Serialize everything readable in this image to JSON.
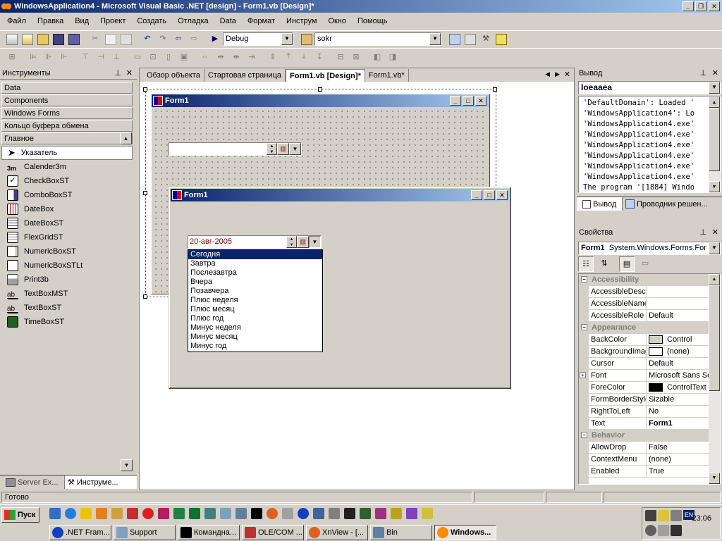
{
  "window": {
    "title": "WindowsApplication4 - Microsoft Visual Basic .NET [design] - Form1.vb [Design]*"
  },
  "menu": [
    "Файл",
    "Правка",
    "Вид",
    "Проект",
    "Создать",
    "Отладка",
    "Data",
    "Формат",
    "Инструм",
    "Окно",
    "Помощь"
  ],
  "toolbar": {
    "config": "Debug",
    "find": "sokr"
  },
  "toolbox": {
    "title": "Инструменты",
    "categories": [
      "Data",
      "Components",
      "Windows Forms",
      "Кольцо буфера обмена",
      "Главное"
    ],
    "items": [
      "Указатель",
      "Calender3m",
      "CheckBoxST",
      "ComboBoxST",
      "DateBox",
      "DateBoxST",
      "FlexGridST",
      "NumericBoxST",
      "NumericBoxSTLt",
      "Print3b",
      "TextBoxMST",
      "TextBoxST",
      "TimeBoxST"
    ],
    "bottom_tabs": [
      "Server Ex...",
      "Инструме..."
    ]
  },
  "doc_tabs": [
    "Обзор объекта",
    "Стартовая страница",
    "Form1.vb [Design]*",
    "Form1.vb*"
  ],
  "designer": {
    "form_title": "Form1"
  },
  "runtime_form": {
    "title": "Form1",
    "date_value": "20-авг-2005",
    "list": [
      "Сегодня",
      "Завтра",
      "Послезавтра",
      "Вчера",
      "Позавчера",
      "Плюс неделя",
      "Плюс месяц",
      "Плюс год",
      "Минус неделя",
      "Минус месяц",
      "Минус год"
    ]
  },
  "output": {
    "title": "Вывод",
    "pane": "Ioeaaea",
    "lines": [
      " 'DefaultDomain': Loaded '",
      " 'WindowsApplication4': Lo",
      " 'WindowsApplication4.exe'",
      " 'WindowsApplication4.exe'",
      " 'WindowsApplication4.exe'",
      " 'WindowsApplication4.exe'",
      " 'WindowsApplication4.exe'",
      " 'WindowsApplication4.exe'",
      " The program '[1884] Windo"
    ],
    "tabs": [
      "Вывод",
      "Проводник решен..."
    ]
  },
  "properties": {
    "title": "Свойства",
    "object_name": "Form1",
    "object_type": "System.Windows.Forms.For",
    "cat_accessibility": "Accessibility",
    "cat_appearance": "Appearance",
    "cat_behavior": "Behavior",
    "rows_accessibility": [
      {
        "name": "AccessibleDescrip",
        "value": ""
      },
      {
        "name": "AccessibleName",
        "value": ""
      },
      {
        "name": "AccessibleRole",
        "value": "Default"
      }
    ],
    "rows_appearance": [
      {
        "name": "BackColor",
        "value": "Control",
        "swatch": "#d4d0c8"
      },
      {
        "name": "BackgroundImag",
        "value": "(none)",
        "swatch": "#ffffff"
      },
      {
        "name": "Cursor",
        "value": "Default"
      },
      {
        "name": "Font",
        "value": "Microsoft Sans Ser",
        "expand": "+"
      },
      {
        "name": "ForeColor",
        "value": "ControlText",
        "swatch": "#000000"
      },
      {
        "name": "FormBorderStyle",
        "value": "Sizable"
      },
      {
        "name": "RightToLeft",
        "value": "No"
      },
      {
        "name": "Text",
        "value": "Form1",
        "bold": true
      }
    ],
    "rows_behavior": [
      {
        "name": "AllowDrop",
        "value": "False"
      },
      {
        "name": "ContextMenu",
        "value": "(none)"
      },
      {
        "name": "Enabled",
        "value": "True"
      }
    ]
  },
  "status": {
    "text": "Готово"
  },
  "taskbar": {
    "start": "Пуск",
    "clock": "23:06",
    "lang": "EN",
    "buttons": [
      ".NET Fram...",
      "Support",
      "Командна...",
      "OLE/COM ...",
      "XnView - [...",
      "Bin",
      "Windows..."
    ]
  },
  "colors": {
    "title_start": "#0a246a",
    "title_end": "#a6caf0",
    "face": "#d4d0c8",
    "selection": "#0a246a"
  }
}
